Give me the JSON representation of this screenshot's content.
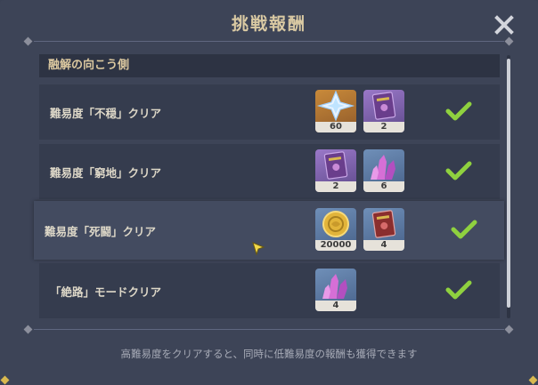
{
  "dialog": {
    "title": "挑戦報酬",
    "section_header": "融解の向こう側",
    "footer_note": "高難易度をクリアすると、同時に低難易度の報酬も獲得できます"
  },
  "rows": [
    {
      "label": "難易度「不穏」クリア",
      "completed": true,
      "rewards": [
        {
          "icon": "crystal-star-icon",
          "count": "60"
        },
        {
          "icon": "purple-book-icon",
          "count": "2"
        }
      ]
    },
    {
      "label": "難易度「窮地」クリア",
      "completed": true,
      "rewards": [
        {
          "icon": "purple-book-icon",
          "count": "2"
        },
        {
          "icon": "pink-crystal-icon",
          "count": "6"
        }
      ]
    },
    {
      "label": "難易度「死闘」クリア",
      "completed": true,
      "rewards": [
        {
          "icon": "mora-coin-icon",
          "count": "20000"
        },
        {
          "icon": "red-book-icon",
          "count": "4"
        }
      ]
    },
    {
      "label": "「絶路」モードクリア",
      "completed": true,
      "rewards": [
        {
          "icon": "pink-crystal-icon",
          "count": "4"
        }
      ]
    }
  ],
  "colors": {
    "check": "#8fd13f",
    "title": "#d9c9a3",
    "panel": "#3d4457"
  }
}
